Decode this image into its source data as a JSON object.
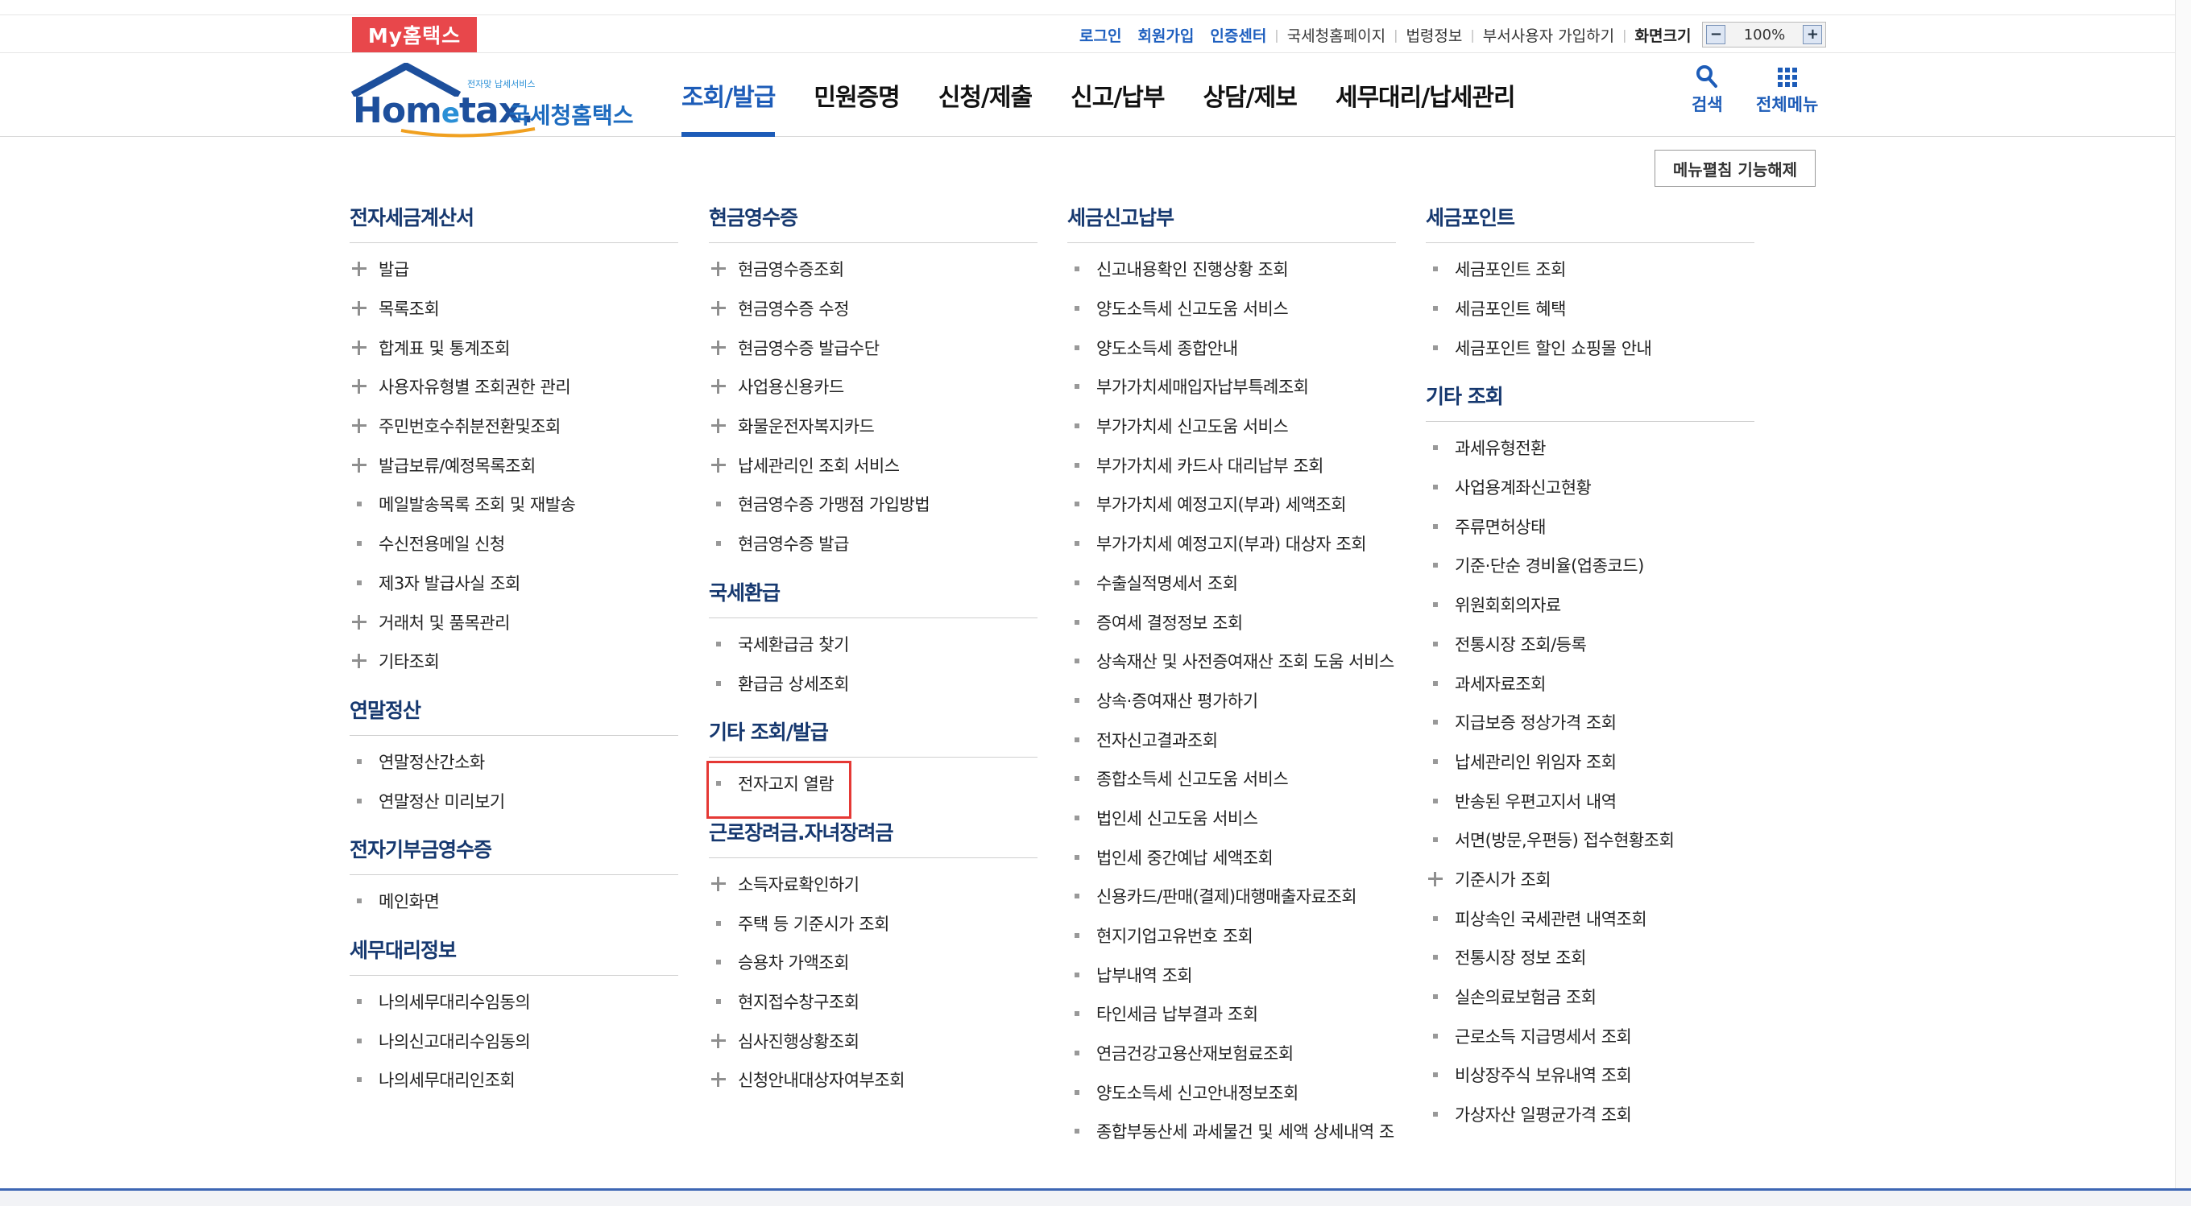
{
  "topbar": {
    "my_label": "My홈택스",
    "links_blue": [
      "로그인",
      "회원가입",
      "인증센터"
    ],
    "links_gray": [
      "국세청홈페이지",
      "법령정보",
      "부서사용자 가입하기"
    ],
    "screen_size_label": "화면크기",
    "zoom_minus": "−",
    "zoom_value": "100%",
    "zoom_plus": "+"
  },
  "header": {
    "logo_small": "전자맞 납세서비스",
    "logo_main": "Hom",
    "logo_e": "e",
    "logo_tail": "tax.",
    "logo_kor": "국세청홈택스",
    "nav": [
      {
        "label": "조회/발급",
        "active": true
      },
      {
        "label": "민원증명"
      },
      {
        "label": "신청/제출"
      },
      {
        "label": "신고/납부"
      },
      {
        "label": "상담/제보"
      },
      {
        "label": "세무대리/납세관리"
      }
    ],
    "search_label": "검색",
    "allmenu_label": "전체메뉴"
  },
  "fold_button": "메뉴펼침 기능해제",
  "columns": [
    {
      "sections": [
        {
          "title": "전자세금계산서",
          "items": [
            {
              "label": "발급",
              "mark": "plus"
            },
            {
              "label": "목록조회",
              "mark": "plus"
            },
            {
              "label": "합계표 및 통계조회",
              "mark": "plus"
            },
            {
              "label": "사용자유형별 조회권한 관리",
              "mark": "plus"
            },
            {
              "label": "주민번호수취분전환및조회",
              "mark": "plus"
            },
            {
              "label": "발급보류/예정목록조회",
              "mark": "plus"
            },
            {
              "label": "메일발송목록 조회 및 재발송",
              "mark": "dot"
            },
            {
              "label": "수신전용메일 신청",
              "mark": "dot"
            },
            {
              "label": "제3자 발급사실 조회",
              "mark": "dot"
            },
            {
              "label": "거래처 및 품목관리",
              "mark": "plus"
            },
            {
              "label": "기타조회",
              "mark": "plus"
            }
          ]
        },
        {
          "title": "연말정산",
          "items": [
            {
              "label": "연말정산간소화",
              "mark": "dot"
            },
            {
              "label": "연말정산 미리보기",
              "mark": "dot"
            }
          ]
        },
        {
          "title": "전자기부금영수증",
          "items": [
            {
              "label": "메인화면",
              "mark": "dot"
            }
          ]
        },
        {
          "title": "세무대리정보",
          "items": [
            {
              "label": "나의세무대리수임동의",
              "mark": "dot"
            },
            {
              "label": "나의신고대리수임동의",
              "mark": "dot"
            },
            {
              "label": "나의세무대리인조회",
              "mark": "dot"
            }
          ]
        }
      ]
    },
    {
      "sections": [
        {
          "title": "현금영수증",
          "items": [
            {
              "label": "현금영수증조회",
              "mark": "plus"
            },
            {
              "label": "현금영수증 수정",
              "mark": "plus"
            },
            {
              "label": "현금영수증 발급수단",
              "mark": "plus"
            },
            {
              "label": "사업용신용카드",
              "mark": "plus"
            },
            {
              "label": "화물운전자복지카드",
              "mark": "plus"
            },
            {
              "label": "납세관리인 조회 서비스",
              "mark": "plus"
            },
            {
              "label": "현금영수증 가맹점 가입방법",
              "mark": "dot"
            },
            {
              "label": "현금영수증 발급",
              "mark": "dot"
            }
          ]
        },
        {
          "title": "국세환급",
          "items": [
            {
              "label": "국세환급금 찾기",
              "mark": "dot"
            },
            {
              "label": "환급금 상세조회",
              "mark": "dot"
            }
          ]
        },
        {
          "title": "기타 조회/발급",
          "items": [
            {
              "label": "전자고지 열람",
              "mark": "dot",
              "highlight": true
            }
          ]
        },
        {
          "title": "근로장려금.자녀장려금",
          "items": [
            {
              "label": "소득자료확인하기",
              "mark": "plus"
            },
            {
              "label": "주택 등 기준시가 조회",
              "mark": "dot"
            },
            {
              "label": "승용차 가액조회",
              "mark": "dot"
            },
            {
              "label": "현지접수창구조회",
              "mark": "dot"
            },
            {
              "label": "심사진행상황조회",
              "mark": "plus"
            },
            {
              "label": "신청안내대상자여부조회",
              "mark": "plus"
            }
          ]
        }
      ]
    },
    {
      "sections": [
        {
          "title": "세금신고납부",
          "items": [
            {
              "label": "신고내용확인 진행상황 조회",
              "mark": "dot"
            },
            {
              "label": "양도소득세 신고도움 서비스",
              "mark": "dot"
            },
            {
              "label": "양도소득세 종합안내",
              "mark": "dot"
            },
            {
              "label": "부가가치세매입자납부특례조회",
              "mark": "dot"
            },
            {
              "label": "부가가치세 신고도움 서비스",
              "mark": "dot"
            },
            {
              "label": "부가가치세 카드사 대리납부 조회",
              "mark": "dot"
            },
            {
              "label": "부가가치세 예정고지(부과) 세액조회",
              "mark": "dot"
            },
            {
              "label": "부가가치세 예정고지(부과) 대상자 조회",
              "mark": "dot"
            },
            {
              "label": "수출실적명세서 조회",
              "mark": "dot"
            },
            {
              "label": "증여세 결정정보 조회",
              "mark": "dot"
            },
            {
              "label": "상속재산 및 사전증여재산 조회 도움 서비스",
              "mark": "dot"
            },
            {
              "label": "상속·증여재산 평가하기",
              "mark": "dot"
            },
            {
              "label": "전자신고결과조회",
              "mark": "dot"
            },
            {
              "label": "종합소득세 신고도움 서비스",
              "mark": "dot"
            },
            {
              "label": "법인세 신고도움 서비스",
              "mark": "dot"
            },
            {
              "label": "법인세 중간예납 세액조회",
              "mark": "dot"
            },
            {
              "label": "신용카드/판매(결제)대행매출자료조회",
              "mark": "dot"
            },
            {
              "label": "현지기업고유번호 조회",
              "mark": "dot"
            },
            {
              "label": "납부내역 조회",
              "mark": "dot"
            },
            {
              "label": "타인세금 납부결과 조회",
              "mark": "dot"
            },
            {
              "label": "연금건강고용산재보험료조회",
              "mark": "dot"
            },
            {
              "label": "양도소득세 신고안내정보조회",
              "mark": "dot"
            },
            {
              "label": "종합부동산세 과세물건 및 세액 상세내역 조",
              "mark": "dot"
            }
          ]
        }
      ]
    },
    {
      "sections": [
        {
          "title": "세금포인트",
          "items": [
            {
              "label": "세금포인트 조회",
              "mark": "dot"
            },
            {
              "label": "세금포인트 혜택",
              "mark": "dot"
            },
            {
              "label": "세금포인트 할인 쇼핑몰 안내",
              "mark": "dot"
            }
          ]
        },
        {
          "title": "기타 조회",
          "items": [
            {
              "label": "과세유형전환",
              "mark": "dot"
            },
            {
              "label": "사업용계좌신고현황",
              "mark": "dot"
            },
            {
              "label": "주류면허상태",
              "mark": "dot"
            },
            {
              "label": "기준·단순 경비율(업종코드)",
              "mark": "dot"
            },
            {
              "label": "위원회회의자료",
              "mark": "dot"
            },
            {
              "label": "전통시장 조회/등록",
              "mark": "dot"
            },
            {
              "label": "과세자료조회",
              "mark": "dot"
            },
            {
              "label": "지급보증 정상가격 조회",
              "mark": "dot"
            },
            {
              "label": "납세관리인 위임자 조회",
              "mark": "dot"
            },
            {
              "label": "반송된 우편고지서 내역",
              "mark": "dot"
            },
            {
              "label": "서면(방문,우편등) 접수현황조회",
              "mark": "dot"
            },
            {
              "label": "기준시가 조회",
              "mark": "plus"
            },
            {
              "label": "피상속인 국세관련 내역조회",
              "mark": "dot"
            },
            {
              "label": "전통시장 정보 조회",
              "mark": "dot"
            },
            {
              "label": "실손의료보험금 조회",
              "mark": "dot"
            },
            {
              "label": "근로소득 지급명세서 조회",
              "mark": "dot"
            },
            {
              "label": "비상장주식 보유내역 조회",
              "mark": "dot"
            },
            {
              "label": "가상자산 일평균가격 조회",
              "mark": "dot"
            }
          ]
        }
      ]
    }
  ]
}
